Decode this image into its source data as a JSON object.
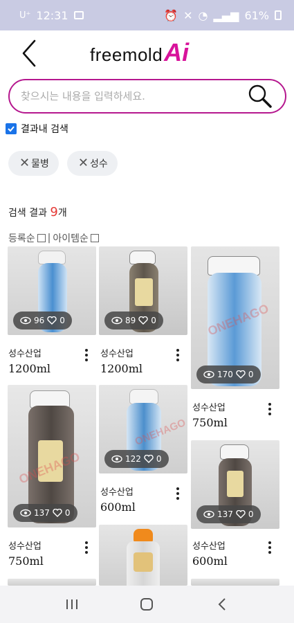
{
  "status_bar": {
    "carrier": "U⁺",
    "time": "12:31",
    "battery": "61%"
  },
  "header": {
    "logo_text": "freemold",
    "logo_ai": "Ai"
  },
  "search": {
    "placeholder": "찾으시는 내용을 입력하세요."
  },
  "filters": {
    "within_results_label": "결과내 검색",
    "within_results_checked": true,
    "chips": [
      {
        "label": "물병"
      },
      {
        "label": "성수"
      }
    ]
  },
  "results": {
    "prefix": "검색 결과 ",
    "count": "9",
    "suffix": "개"
  },
  "sort": {
    "option1": "등록순",
    "separator": "|",
    "option2": "아이템순"
  },
  "watermark": "ONEHAGO",
  "products": [
    {
      "brand": "성수산업",
      "size": "1200ml",
      "views": "96",
      "likes": "0"
    },
    {
      "brand": "성수산업",
      "size": "1200ml",
      "views": "89",
      "likes": "0"
    },
    {
      "brand": "성수산업",
      "size": "750ml",
      "views": "170",
      "likes": "0"
    },
    {
      "brand": "성수산업",
      "size": "750ml",
      "views": "137",
      "likes": "0"
    },
    {
      "brand": "성수산업",
      "size": "600ml",
      "views": "122",
      "likes": "0"
    },
    {
      "brand": "성수산업",
      "size": "600ml",
      "views": "137",
      "likes": "0"
    }
  ],
  "colors": {
    "accent": "#b5178e",
    "count_red": "#e53935",
    "checkbox_blue": "#1a73e8",
    "status_bar": "#c9cbe3"
  }
}
